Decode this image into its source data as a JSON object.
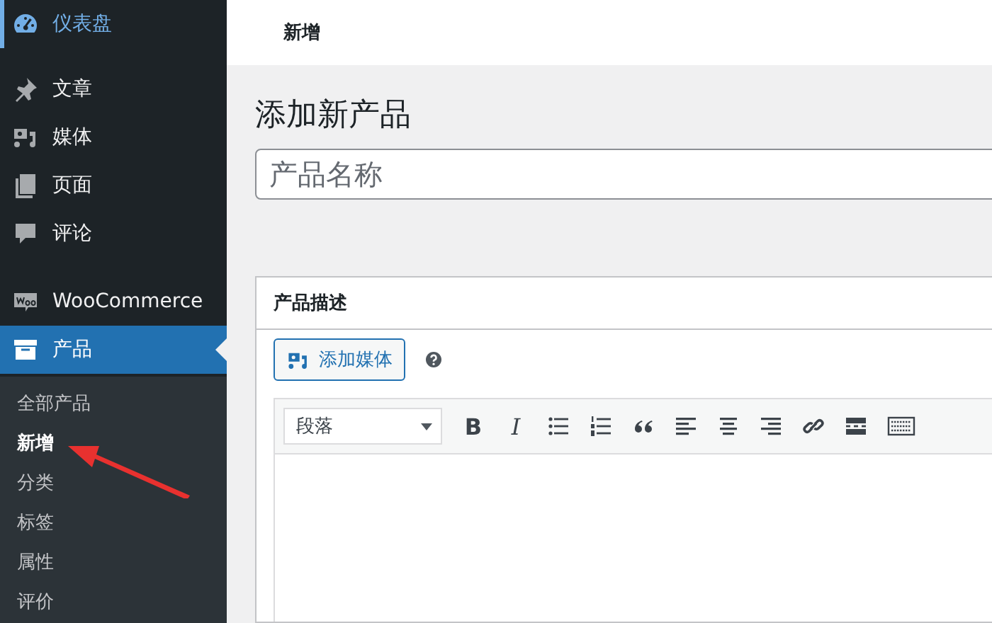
{
  "sidebar": {
    "menu_groups": [
      [
        {
          "kind": "dashboard",
          "label": "仪表盘",
          "hovered": true,
          "selected": false
        }
      ],
      [
        {
          "kind": "pin",
          "label": "文章",
          "hovered": false,
          "selected": false
        },
        {
          "kind": "media",
          "label": "媒体",
          "hovered": false,
          "selected": false
        },
        {
          "kind": "page",
          "label": "页面",
          "hovered": false,
          "selected": false
        },
        {
          "kind": "comment",
          "label": "评论",
          "hovered": false,
          "selected": false
        }
      ],
      [
        {
          "kind": "woo",
          "label": "WooCommerce",
          "hovered": false,
          "selected": false
        },
        {
          "kind": "archive",
          "label": "产品",
          "hovered": false,
          "selected": true
        }
      ]
    ],
    "submenu": [
      {
        "label": "全部产品",
        "selected": false
      },
      {
        "label": "新增",
        "selected": true
      },
      {
        "label": "分类",
        "selected": false
      },
      {
        "label": "标签",
        "selected": false
      },
      {
        "label": "属性",
        "selected": false
      },
      {
        "label": "评价",
        "selected": false
      }
    ]
  },
  "top_bar": {
    "title": "新增"
  },
  "page_title": "添加新产品",
  "title_field": {
    "placeholder": "产品名称"
  },
  "description_panel": {
    "title": "产品描述",
    "add_media_button": "添加媒体",
    "format_select": "段落",
    "toolbar": [
      {
        "kind": "bold",
        "label": "B"
      },
      {
        "kind": "italic",
        "label": "I"
      },
      {
        "kind": "bullets"
      },
      {
        "kind": "numbers"
      },
      {
        "kind": "quote"
      },
      {
        "kind": "align-left"
      },
      {
        "kind": "align-center"
      },
      {
        "kind": "align-right"
      },
      {
        "kind": "link"
      },
      {
        "kind": "more"
      },
      {
        "kind": "keyboard"
      }
    ]
  }
}
